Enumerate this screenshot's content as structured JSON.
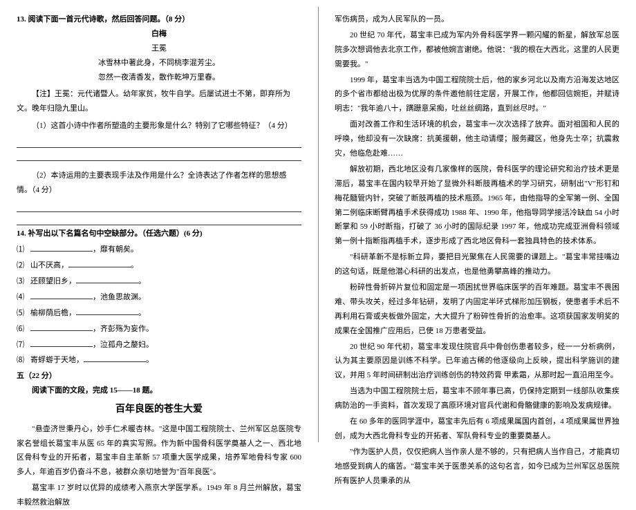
{
  "left": {
    "q13_header": "13. 阅读下面一首元代诗歌，然后回答问题。（8 分）",
    "poem_title": "白梅",
    "poem_author": "王冕",
    "poem_line1": "冰雪林中著此身，不同桃李混芳尘。",
    "poem_line2": "忽然一夜清香发，散作乾坤万里春。",
    "poem_note": "【注】王冕：元代诸暨人。幼年家贫，牧牛自学。后屡试进士不第，即弃所为文。晚年归隐九里山。",
    "q13_sub1": "（1）这首小诗中作者所塑造的主要形象是什么？特别了它哪些特征？（4 分）",
    "q13_sub2": "（2）本诗运用的主要表现手法及作用是什么？全诗表达了作者怎样的思想感情。（4 分）",
    "q14_header": "14.  补写出以下名篇名句中空缺部分。（任选六题）(6 分)",
    "fill_items": [
      {
        "num": "⑴",
        "pre": "",
        "post": "，靡有朝矣。"
      },
      {
        "num": "⑵",
        "pre": "山不厌高，",
        "post": "。"
      },
      {
        "num": "⑶",
        "pre": "还顾望旧乡，",
        "post": "。"
      },
      {
        "num": "⑷",
        "pre": "",
        "post": "，池鱼思故渊。"
      },
      {
        "num": "⑸",
        "pre": "榆柳荫后檐，",
        "post": "。"
      },
      {
        "num": "⑹",
        "pre": "",
        "post": "，齐彭殇为妄作。"
      },
      {
        "num": "⑺",
        "pre": "",
        "post": "，泣孤舟之嫠妇。"
      },
      {
        "num": "⑻",
        "pre": "寄蜉蝣于天地，",
        "post": "。"
      }
    ],
    "section5": "五（22 分）",
    "read_prompt": "阅读下面的文段，完成 15——18 题。",
    "essay_title": "百年良医的苍生大爱",
    "p_left1": "\"悬壶济世秉丹心，妙手仁术暖杏林。\"这是中国工程院院士、兰州军区总医院专家名誉组长葛宝丰从医 65 年的真实写照。作为新中国骨科医学奠基人之一、西北地区骨科专业的开拓者，葛宝丰自主革新 57 项重大医学成果，培养军地骨科专家 600 多人，年逾百岁仍奋斗不息，被群众亲切地誉为\"百年良医\"。",
    "p_left2": "葛宝丰 17 岁时以优异的成绩考入燕京大学医学系。1949 年 8 月兰州解放，葛宝丰毅然救治解放"
  },
  "right": {
    "p1": "军伤病员，成为人民军队的一员。",
    "p2": "20 世纪 70 年代，葛宝丰已成为军内外骨科医学界一颗闪耀的新星，解放军总医院多次想调他去北京工作，都被他婉言谢绝。他说：\"我的根在大西北，这里的人民更需要我。\"",
    "p3": "1999 年，葛宝丰当选为中国工程院院士后，他的家乡河北以及南方沿海发达地区的多个省市都给出极为优厚的条件邀他前往定居，开展工作，他都回信婉拒，并赋诗明志：\"我年逾八十，蹒跚意呆痴，吐丝丝绸路，直到丝尽时。\"",
    "p4": "面对改善工作和生活环境的机会，葛宝丰一次次选择了放弃。面对祖国和人民的呼唤，他却没有一次缺席：抗美援朝，他主动请缨；服务藏区，他身先士卒；抗震救灾，他临危赴难……",
    "p5": "解放初期，西北地区没有几家像样的医院，骨科医学的理论研究和治疗技术更是滞后，葛宝丰在国内较早开始了显微外科断肢再植术的学习研究，研制出\"V\"形钉和梅花髓管内针，突破了断肢再植的技术瓶颈。1965 年，由他指导的全军第一例、全国第二例临床断臂再植手术获得成功 1988 年、1990 年，他指导同学接活冷缺血 54 小时断掌和 59 小时断指，打破了 36 小时的国际纪录 1997 年，他成功完成亚洲骨科领域第一例十指断指再植手术，逐步形成了西北地区骨科一套独具特色的技术体系。",
    "p6": "\"科研革新不是标新立异，要把目光聚焦在人民需要的课题上。\"葛宝丰常挂嘴边的这句话，既是他潜心科研的出发点，也是他勇攀高峰的推动力。",
    "p7": "粉碎性骨折碎片复位和固定是一项困扰世界临床医学的百年难题。葛宝丰不畏困难、带头攻关，经过多年钻研，发明了内固定半环式梯形加压钢板，使患者手术后不再利用石膏或夹板做外固定，大大提升了粉碎性骨折的治愈率。这项获国家发明奖的成果在全国推广应用后，已使 18 万患者受益。",
    "p8": "20 世纪 90 年代初，葛宝丰发现住院官兵中骨创伤患者较多，经一一分析病例，认为其主要原因是训练不科学。已年逾古稀的他逐级向上反映，提出科学施训的建议，并用 5 年时间研制出治疗训练创伤的特效药膏  甲素霜，从那时起一直沿用至今。",
    "p9": "当选为中国工程院院士后，葛宝丰不顾年事已高，仍保持定期到一线部队收集疾病防治的一手资料，首次发现了高原环境对官兵代谢和骨骼健康的影响及发病规律。",
    "p10": "在 60 多年的医同学涯中，葛宝丰先后有 6 项成果属国内首创，4 项成果属世界独创，成为大西北骨科专业的开拓者、军队骨科专业的重要奠基人。",
    "p11": "\"作为医护人员，仅仅把病人当作亲人是不够的，只有把病人当作自己，才能真切地感受到病人的痛苦。\"葛宝丰关于医患关系的这句名言，如今已成为兰州军区总医院所有医护人员秉承的从"
  }
}
